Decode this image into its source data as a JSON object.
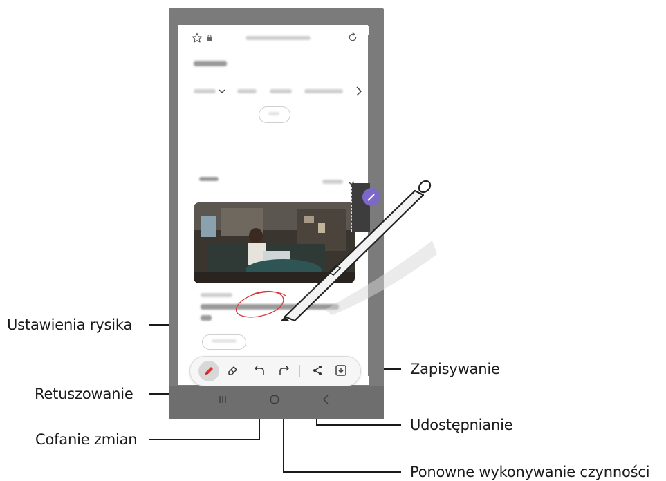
{
  "callouts": {
    "pen_settings": "Ustawienia rysika",
    "eraser": "Retuszowanie",
    "undo": "Cofanie zmian",
    "redo": "Ponowne wykonywanie czynności",
    "share": "Udostępnianie",
    "save": "Zapisywanie"
  },
  "icons": {
    "star": "star-outline-icon",
    "lock": "lock-icon",
    "reload": "reload-icon",
    "dropdown": "chevron-down-icon",
    "next": "chevron-right-icon",
    "pen": "pen-icon",
    "eraser": "eraser-icon",
    "undo": "undo-arrow-icon",
    "redo": "redo-arrow-icon",
    "share": "share-icon",
    "save": "download-icon"
  },
  "colors": {
    "pen_accent": "#e0312c",
    "annotation_ink": "#d43a3a",
    "phone_frame": "#7b7b7b"
  }
}
